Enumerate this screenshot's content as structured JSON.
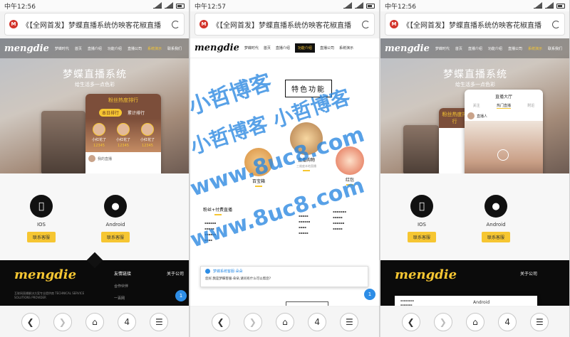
{
  "screens": [
    {
      "time": "中午12:56",
      "url": "《【全网首发】梦蝶直播系统仿映客花椒直播"
    },
    {
      "time": "中午12:57",
      "url": "《【全网首发】梦蝶直播系统仿映客花椒直播"
    },
    {
      "time": "中午12:56",
      "url": "《【全网首发】梦蝶直播系统仿映客花椒直播"
    }
  ],
  "site": {
    "logo": "mengdie",
    "logo_sub": "梦蝶时代",
    "nav": [
      "首页",
      "直播介绍",
      "功能介绍",
      "直播公司",
      "系统演示",
      "联系我们"
    ],
    "hero_title": "梦蝶直播系统",
    "hero_sub": "给生活多一点色彩"
  },
  "rank_card": {
    "title": "粉丝热度排行",
    "tabs": [
      "本日排行",
      "累计排行"
    ],
    "users": [
      {
        "name": "小红花了",
        "score": "12345"
      },
      {
        "name": "小红花了",
        "score": "12345"
      },
      {
        "name": "小红花了",
        "score": "12345"
      }
    ],
    "footer": "我的直播"
  },
  "downloads": [
    {
      "label": "IOS",
      "button": "联系客服"
    },
    {
      "label": "Android",
      "button": "联系客服"
    }
  ],
  "footer": {
    "logo": "mengdie",
    "col1": "友情链接",
    "col1_links": [
      "合作伙伴",
      "一百网"
    ],
    "col2": "关于公司",
    "desc": "互联网直播解决方案专业提供商 TECHNICAL SERVICE SOLUTIONS PROVIDER"
  },
  "screen2": {
    "features_title": "特色功能",
    "features": [
      {
        "name": "百宝箱"
      },
      {
        "name": "直播购物",
        "desc": "三维度本地直播"
      },
      {
        "name": "红包"
      }
    ],
    "extra": "粉丝+付费直播",
    "chat_from": "梦蝶系统客服·朵朵",
    "chat_msg": "您好,我是梦蝶客服·朵朵,请问有什么可以帮您?"
  },
  "screen3": {
    "live_hall": "直播大厅",
    "tabs": [
      "关注",
      "热门直播",
      "附近"
    ],
    "host": "直播人"
  },
  "watermarks": [
    "小哲博客",
    "小哲博客 小哲博客",
    "www.8uc8.com"
  ],
  "toolbar": {
    "tabs": "4"
  },
  "colors": {
    "accent": "#f6c632",
    "watermark": "#2986e0",
    "chat": "#2d8de6"
  }
}
